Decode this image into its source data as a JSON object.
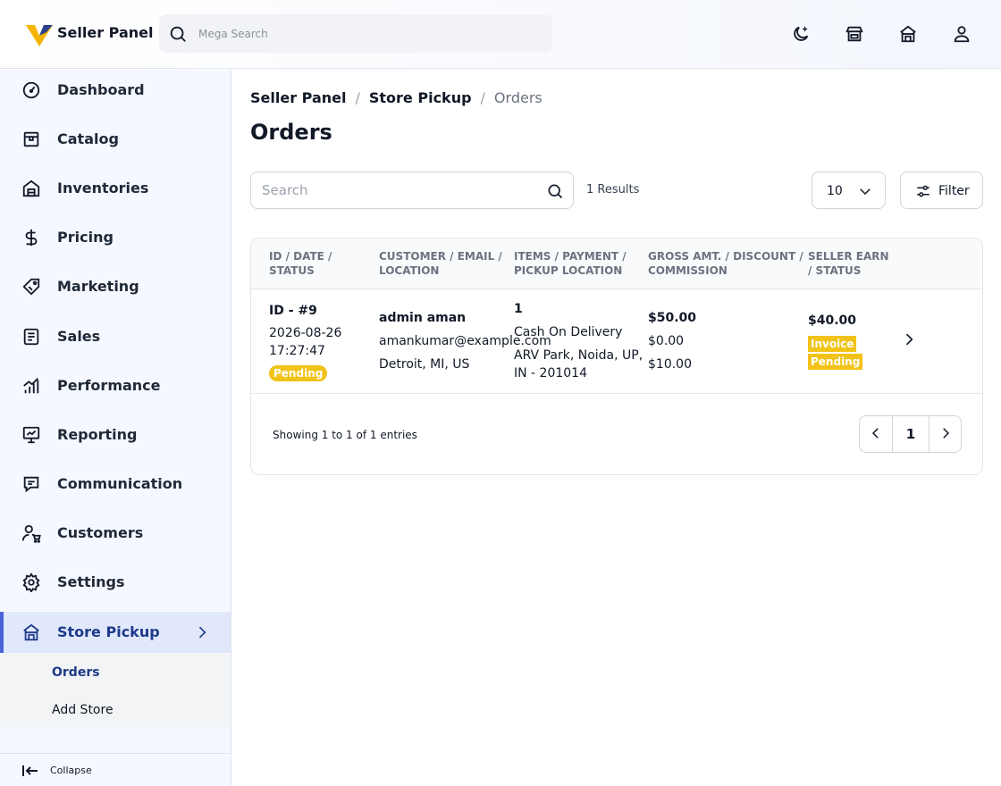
{
  "header": {
    "brand": "Seller Panel",
    "search_placeholder": "Mega Search",
    "icons": [
      "moon-icon",
      "store-icon",
      "shop-icon",
      "user-icon"
    ]
  },
  "sidebar": {
    "items": [
      {
        "label": "Dashboard",
        "icon": "gauge-icon"
      },
      {
        "label": "Catalog",
        "icon": "box-icon"
      },
      {
        "label": "Inventories",
        "icon": "warehouse-icon"
      },
      {
        "label": "Pricing",
        "icon": "dollar-icon"
      },
      {
        "label": "Marketing",
        "icon": "tag-icon"
      },
      {
        "label": "Sales",
        "icon": "document-icon"
      },
      {
        "label": "Performance",
        "icon": "chart-bars-icon"
      },
      {
        "label": "Reporting",
        "icon": "presentation-icon"
      },
      {
        "label": "Communication",
        "icon": "chat-icon"
      },
      {
        "label": "Customers",
        "icon": "customer-cart-icon"
      },
      {
        "label": "Settings",
        "icon": "gear-icon"
      },
      {
        "label": "Store Pickup",
        "icon": "store-icon",
        "active": true
      }
    ],
    "sub_items": [
      {
        "label": "Orders",
        "active": true
      },
      {
        "label": "Add Store"
      }
    ],
    "collapse_label": "Collapse"
  },
  "breadcrumb": [
    "Seller Panel",
    "Store Pickup",
    "Orders"
  ],
  "page_title": "Orders",
  "toolbar": {
    "search_placeholder": "Search",
    "results": "1 Results",
    "per_page": "10",
    "filter_label": "Filter"
  },
  "table": {
    "headers": [
      [
        "ID / DATE /",
        "STATUS"
      ],
      [
        "CUSTOMER / EMAIL /",
        "LOCATION"
      ],
      [
        "ITEMS / PAYMENT /",
        "PICKUP LOCATION"
      ],
      [
        "GROSS AMT. / DISCOUNT /",
        "COMMISSION"
      ],
      [
        "SELLER EARN",
        "/ STATUS"
      ]
    ],
    "rows": [
      {
        "id": "ID - #9",
        "date": "2026-08-26",
        "time": "17:27:47",
        "status": "Pending",
        "customer": "admin aman",
        "email": "amankumar@example.com",
        "location": "Detroit, MI, US",
        "items": "1",
        "payment": "Cash On Delivery",
        "pickup_line1": "ARV Park, Noida, UP,",
        "pickup_line2": "IN - 201014",
        "gross": "$50.00",
        "discount": "$0.00",
        "commission": "$10.00",
        "seller_earn": "$40.00",
        "invoice_status_1": "Invoice",
        "invoice_status_2": "Pending"
      }
    ],
    "showing": "Showing 1 to 1 of 1 entries",
    "current_page": "1"
  },
  "colors": {
    "accent": "#4a63d6",
    "badge": "#f1c319",
    "logo_yellow": "#f5b400",
    "logo_blue": "#2c3f8f"
  }
}
